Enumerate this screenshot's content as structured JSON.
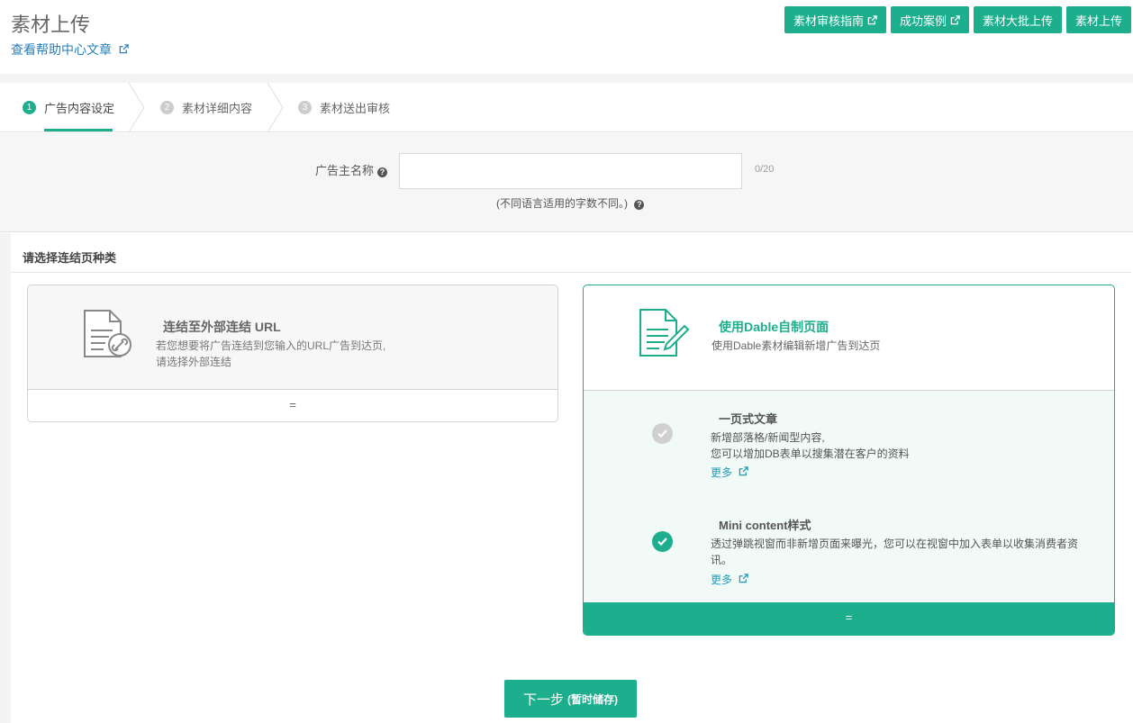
{
  "header": {
    "title": "素材上传",
    "help_link": "查看帮助中心文章",
    "actions": [
      "素材审核指南",
      "成功案例",
      "素材大批上传",
      "素材上传"
    ]
  },
  "steps": [
    {
      "num": "1",
      "label": "广告内容设定",
      "active": true
    },
    {
      "num": "2",
      "label": "素材详细内容",
      "active": false
    },
    {
      "num": "3",
      "label": "素材送出审核",
      "active": false
    }
  ],
  "form": {
    "label": "广告主名称",
    "value": "",
    "counter": "0/20",
    "hint": "(不同语言适用的字数不同。)"
  },
  "panel": {
    "title": "请选择连结页种类",
    "external": {
      "title": "连结至外部连结 URL",
      "desc_1": "若您想要将广告连结到您输入的URL广告到达页,",
      "desc_2": "请选择外部连结",
      "footer": "="
    },
    "dable": {
      "title": "使用Dable自制页面",
      "desc": "使用Dable素材编辑新增广告到达页",
      "footer": "=",
      "options": [
        {
          "title": "一页式文章",
          "desc_1": "新增部落格/新闻型内容,",
          "desc_2": "您可以增加DB表单以搜集潜在客户的资料",
          "more": "更多",
          "selected": false
        },
        {
          "title": "Mini content样式",
          "desc_1": "透过弹跳视窗而非新增页面来曝光，您可以在视窗中加入表单以收集消费者资",
          "desc_2": "讯。",
          "more": "更多",
          "selected": true
        }
      ]
    }
  },
  "next_button": {
    "label": "下一步",
    "sub": "(暂时储存)"
  },
  "colors": {
    "accent": "#1cae8d",
    "link": "#2a7fb8",
    "selected_bg": "#f1faf7"
  }
}
